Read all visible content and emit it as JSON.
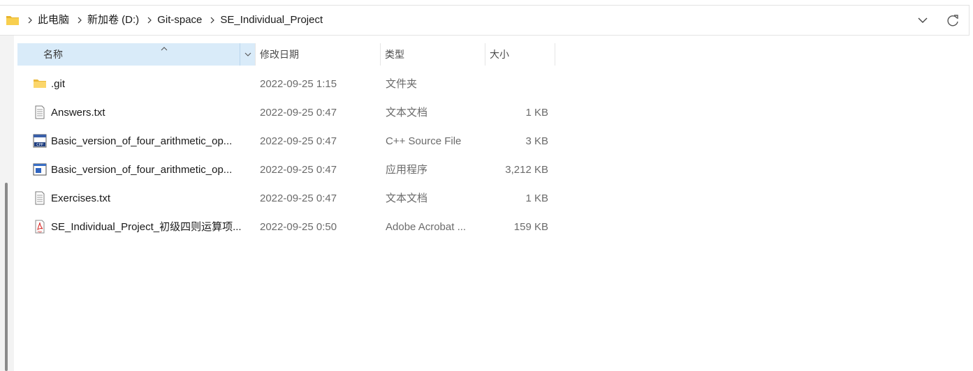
{
  "breadcrumb": {
    "items": [
      "此电脑",
      "新加卷 (D:)",
      "Git-space",
      "SE_Individual_Project"
    ]
  },
  "columns": {
    "name": "名称",
    "date": "修改日期",
    "type": "类型",
    "size": "大小"
  },
  "sort": {
    "column": "name",
    "direction": "ascending"
  },
  "files": [
    {
      "name": ".git",
      "date": "2022-09-25 1:15",
      "type": "文件夹",
      "size": "",
      "icon": "folder-icon"
    },
    {
      "name": "Answers.txt",
      "date": "2022-09-25 0:47",
      "type": "文本文档",
      "size": "1 KB",
      "icon": "text-file-icon"
    },
    {
      "name": "Basic_version_of_four_arithmetic_op...",
      "date": "2022-09-25 0:47",
      "type": "C++ Source File",
      "size": "3 KB",
      "icon": "cpp-file-icon"
    },
    {
      "name": "Basic_version_of_four_arithmetic_op...",
      "date": "2022-09-25 0:47",
      "type": "应用程序",
      "size": "3,212 KB",
      "icon": "application-icon"
    },
    {
      "name": "Exercises.txt",
      "date": "2022-09-25 0:47",
      "type": "文本文档",
      "size": "1 KB",
      "icon": "text-file-icon"
    },
    {
      "name": "SE_Individual_Project_初级四则运算项...",
      "date": "2022-09-25 0:50",
      "type": "Adobe Acrobat ...",
      "size": "159 KB",
      "icon": "pdf-file-icon"
    }
  ],
  "colors": {
    "selected_column_bg": "#d9ebf9",
    "folder_yellow": "#f6c844",
    "pdf_red": "#d9302c"
  }
}
